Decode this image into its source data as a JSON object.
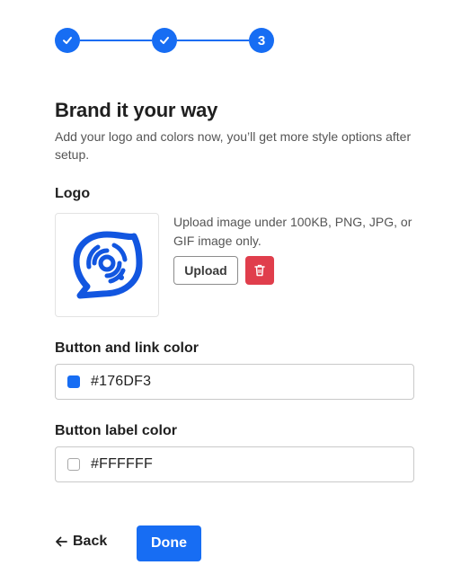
{
  "stepper": {
    "steps": [
      {
        "state": "complete",
        "icon": "check-icon"
      },
      {
        "state": "complete",
        "icon": "check-icon"
      },
      {
        "state": "current",
        "label": "3"
      }
    ],
    "accent_color": "#176DF3"
  },
  "header": {
    "title": "Brand it your way",
    "subtitle": "Add your logo and colors now, you’ll get more style options after setup."
  },
  "logo": {
    "label": "Logo",
    "preview_icon": "brand-logo-icon",
    "hint": "Upload image under 100KB, PNG, JPG, or GIF image only.",
    "upload_label": "Upload",
    "delete_icon": "trash-icon",
    "delete_color": "#E03E4C"
  },
  "link_color": {
    "label": "Button and link color",
    "value": "#176DF3"
  },
  "button_label_color": {
    "label": "Button label color",
    "value": "#FFFFFF"
  },
  "footer": {
    "back_label": "Back",
    "back_icon": "arrow-left-icon",
    "done_label": "Done"
  }
}
